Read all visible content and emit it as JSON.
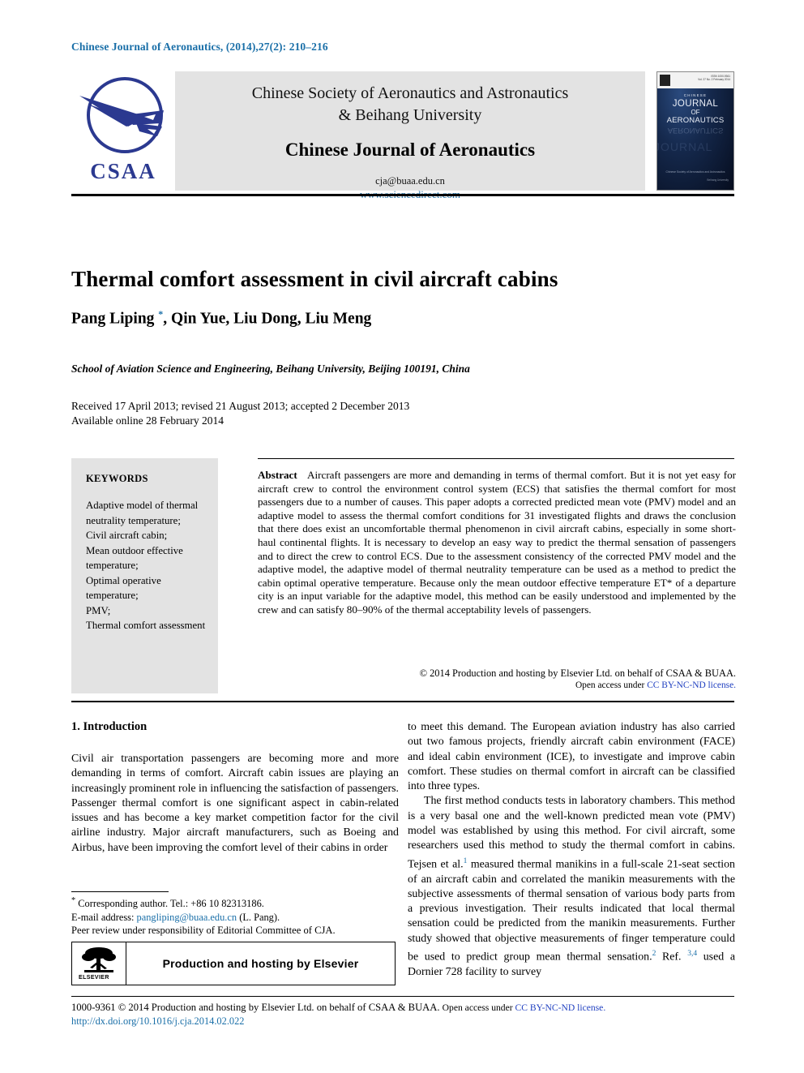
{
  "running_head": "Chinese Journal of Aeronautics, (2014),27(2): 210–216",
  "masthead": {
    "logo_text": "CSAA",
    "society_line1": "Chinese Society of Aeronautics and Astronautics",
    "society_line2": "& Beihang University",
    "journal_name": "Chinese Journal of Aeronautics",
    "email": "cja@buaa.edu.cn",
    "url": "www.sciencedirect.com",
    "cover": {
      "chinese": "CHINESE",
      "word_journal": "JOURNAL",
      "word_of": "OF",
      "word_aeronautics": "AERONAUTICS",
      "issn_line": "ISSN 1000-9361",
      "issue_line": "Vol. 27 No. 2  February 2014",
      "footer_line1": "Chinese Society of Aeronautics and Astronautics",
      "footer_line2": "Beihang University"
    }
  },
  "article": {
    "title": "Thermal comfort assessment in civil aircraft cabins",
    "authors": "Pang Liping ",
    "authors_rest": ", Qin Yue, Liu Dong, Liu Meng",
    "corresponding_marker": "*",
    "affiliation": "School of Aviation Science and Engineering, Beihang University, Beijing 100191, China",
    "received_line": "Received 17 April 2013; revised 21 August 2013; accepted 2 December 2013",
    "available_line": "Available online 28 February 2014"
  },
  "keywords": {
    "heading": "KEYWORDS",
    "items": "Adaptive model of thermal neutrality temperature; Civil aircraft cabin; Mean outdoor effective temperature; Optimal operative temperature; PMV; Thermal comfort assessment",
    "list": [
      "Adaptive model of thermal neutrality temperature;",
      "Civil aircraft cabin;",
      "Mean outdoor effective temperature;",
      "Optimal operative temperature;",
      "PMV;",
      "Thermal comfort assessment"
    ]
  },
  "abstract": {
    "label": "Abstract",
    "text": "Aircraft passengers are more and demanding in terms of thermal comfort. But it is not yet easy for aircraft crew to control the environment control system (ECS) that satisfies the thermal comfort for most passengers due to a number of causes. This paper adopts a corrected predicted mean vote (PMV) model and an adaptive model to assess the thermal comfort conditions for 31 investigated flights and draws the conclusion that there does exist an uncomfortable thermal phenomenon in civil aircraft cabins, especially in some short-haul continental flights. It is necessary to develop an easy way to predict the thermal sensation of passengers and to direct the crew to control ECS. Due to the assessment consistency of the corrected PMV model and the adaptive model, the adaptive model of thermal neutrality temperature can be used as a method to predict the cabin optimal operative temperature. Because only the mean outdoor effective temperature ET* of a departure city is an input variable for the adaptive model, this method can be easily understood and implemented by the crew and can satisfy 80–90% of the thermal acceptability levels of passengers.",
    "copyright_line": "© 2014 Production and hosting by Elsevier Ltd. on behalf of CSAA & BUAA.",
    "open_access_prefix": "Open access under ",
    "license_label": "CC BY-NC-ND license."
  },
  "body": {
    "section_heading": "1. Introduction",
    "left_paragraphs": [
      "Civil air transportation passengers are becoming more and more demanding in terms of comfort. Aircraft cabin issues are playing an increasingly prominent role in influencing the satisfaction of passengers. Passenger thermal comfort is one significant aspect in cabin-related issues and has become a key market competition factor for the civil airline industry. Major aircraft manufacturers, such as Boeing and Airbus, have been improving the comfort level of their cabins in order"
    ],
    "right_paragraph_1": "to meet this demand. The European aviation industry has also carried out two famous projects, friendly aircraft cabin environment (FACE) and ideal cabin environment (ICE), to investigate and improve cabin comfort. These studies on thermal comfort in aircraft can be classified into three types.",
    "right_paragraph_2_a": "The first method conducts tests in laboratory chambers. This method is a very basal one and the well-known predicted mean vote (PMV) model was established by using this method. For civil aircraft, some researchers used this method to study the thermal comfort in cabins. Tejsen et al.",
    "right_ref_1": "1",
    "right_paragraph_2_b": " measured thermal manikins in a full-scale 21-seat section of an aircraft cabin and correlated the manikin measurements with the subjective assessments of thermal sensation of various body parts from a previous investigation. Their results indicated that local thermal sensation could be predicted from the manikin measurements. Further study showed that objective measurements of finger temperature could be used to predict group mean thermal sensation.",
    "right_ref_2": "2",
    "right_paragraph_2_c": " Ref. ",
    "right_ref_3": "3,4",
    "right_paragraph_2_d": " used a Dornier 728 facility to survey"
  },
  "footnote": {
    "star": "*",
    "corresponding": " Corresponding author. Tel.: +86 10 82313186.",
    "email_label": "E-mail address: ",
    "email": "pangliping@buaa.edu.cn",
    "email_suffix": " (L. Pang).",
    "peer_review": "Peer review under responsibility of Editorial Committee of CJA."
  },
  "elsevier_box": {
    "logo_word": "ELSEVIER",
    "text": "Production and hosting by Elsevier"
  },
  "page_footer": {
    "issn_line": "1000-9361 © 2014 Production and hosting by Elsevier Ltd. on behalf of CSAA & BUAA. ",
    "open_access_prefix": "Open access under ",
    "license_label": "CC BY-NC-ND license.",
    "doi": "http://dx.doi.org/10.1016/j.cja.2014.02.022"
  },
  "colors": {
    "header_blue": "#1a6fa8",
    "link_blue": "#1f3fc0",
    "logo_blue": "#2b3990",
    "panel_gray": "#e3e3e3"
  }
}
